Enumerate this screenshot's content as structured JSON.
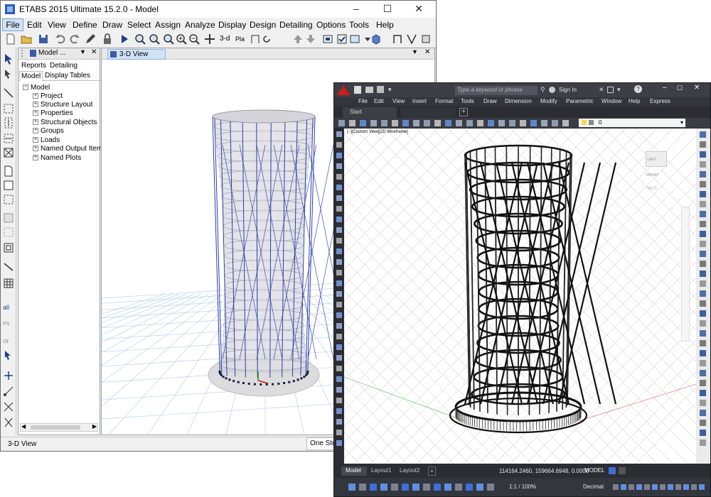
{
  "etabs": {
    "title": "ETABS 2015 Ultimate 15.2.0 - Model",
    "menu": [
      "File",
      "Edit",
      "View",
      "Define",
      "Draw",
      "Select",
      "Assign",
      "Analyze",
      "Display",
      "Design",
      "Detailing",
      "Options",
      "Tools",
      "Help"
    ],
    "model_panel_title": "Model ...",
    "tabs_top": [
      "Reports",
      "Detailing"
    ],
    "tabs_bottom": [
      "Model",
      "Display",
      "Tables"
    ],
    "tree_root": "Model",
    "tree_items": [
      "Project",
      "Structure Layout",
      "Properties",
      "Structural Objects",
      "Groups",
      "Loads",
      "Named Output Items",
      "Named Plots"
    ],
    "view_tab": "3-D View",
    "status_left": "3-D View",
    "status_right": "One Stor",
    "toolbar_label_3d": "3-d",
    "toolbar_label_pla": "Pla",
    "left_label_all": "all",
    "left_label_ps": "PS",
    "left_label_clr": "clr"
  },
  "autocad": {
    "search_placeholder": "Type a keyword or phrase",
    "sign_in": "Sign In",
    "menu": [
      "File",
      "Edit",
      "View",
      "Insert",
      "Format",
      "Tools",
      "Draw",
      "Dimension",
      "Modify",
      "Parametric",
      "Window",
      "Help",
      "Express"
    ],
    "start_tab": "Start",
    "layer_value": "0",
    "viewport_label": "[−][Custom View][2D Wireframe]",
    "viewcube_left": "LEFT",
    "viewcube_front": "FRONT",
    "wcs": "WCS",
    "layout_tabs": [
      "Model",
      "Layout1",
      "Layout2"
    ],
    "coordinates": "114164.2460, 159664.6948, 0.0000",
    "model_button": "MODEL",
    "scale": "1:1 / 100%",
    "units": "Decimal"
  },
  "colors": {
    "etabs_accent": "#cfe3f7",
    "etabs_frame": "#2b3ea8",
    "acad_dark": "#2b2d33"
  }
}
